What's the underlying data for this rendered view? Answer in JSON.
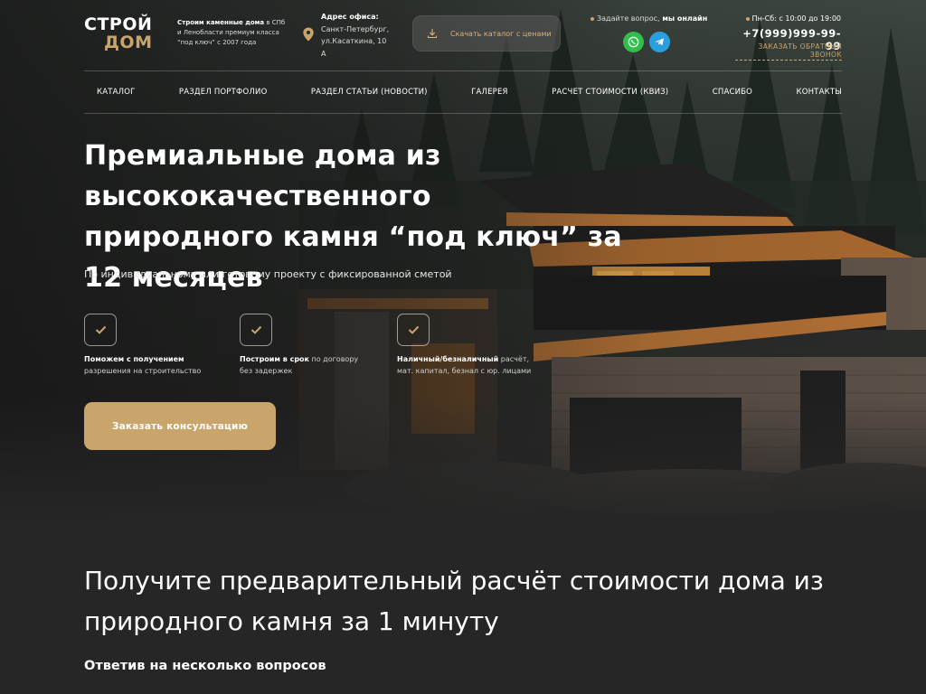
{
  "header": {
    "logo_line1": "СТРОЙ",
    "logo_line2": "ДОМ",
    "tagline_bold": "Строим каменные дома",
    "tagline_rest": " в СПб и Ленобласти премиум класса “под ключ” с 2007 года",
    "address_title": "Адрес офиса:",
    "address_text": "Санкт-Петербург, ул.Касаткина, 10 А",
    "catalog_button": "Скачать каталог с ценами",
    "online_text": "Задайте вопрос,",
    "online_bold": " мы онлайн",
    "hours": "Пн-Сб: с 10:00 до 19:00",
    "phone": "+7(999)999-99-99",
    "callback": "ЗАКАЗАТЬ ОБРАТНЫЙ ЗВОНОК"
  },
  "nav": [
    "КАТАЛОГ",
    "РАЗДЕЛ ПОРТФОЛИО",
    "РАЗДЕЛ СТАТЬИ (НОВОСТИ)",
    "ГАЛЕРЕЯ",
    "РАСЧЕТ СТОИМОСТИ (КВИЗ)",
    "СПАСИБО",
    "КОНТАКТЫ"
  ],
  "hero": {
    "title": "Премиальные дома из высококачественного природного камня “под ключ” за 12 месяцев",
    "subtitle": "По индивидуальному или готовому проекту с фиксированной сметой",
    "features": [
      {
        "bold": "Поможем с получением",
        "line1_rest": "",
        "line2": "разрешения на строительство"
      },
      {
        "bold": "Построим в срок",
        "line1_rest": " по договору",
        "line2": "без задержек"
      },
      {
        "bold": "Наличный/безналичный",
        "line1_rest": " расчёт,",
        "line2": "мат. капитал, безнал с юр. лицами"
      }
    ],
    "cta": "Заказать консультацию"
  },
  "quiz": {
    "title": "Получите предварительный расчёт стоимости дома из природного камня за 1 минуту",
    "subtitle": "Ответив на несколько вопросов"
  },
  "colors": {
    "accent": "#c9a56c",
    "background": "#262626",
    "whatsapp": "#2fbf4a",
    "telegram": "#2a9fe0"
  },
  "icons": [
    "location-pin-icon",
    "download-icon",
    "whatsapp-icon",
    "telegram-icon",
    "checkmark-icon"
  ]
}
